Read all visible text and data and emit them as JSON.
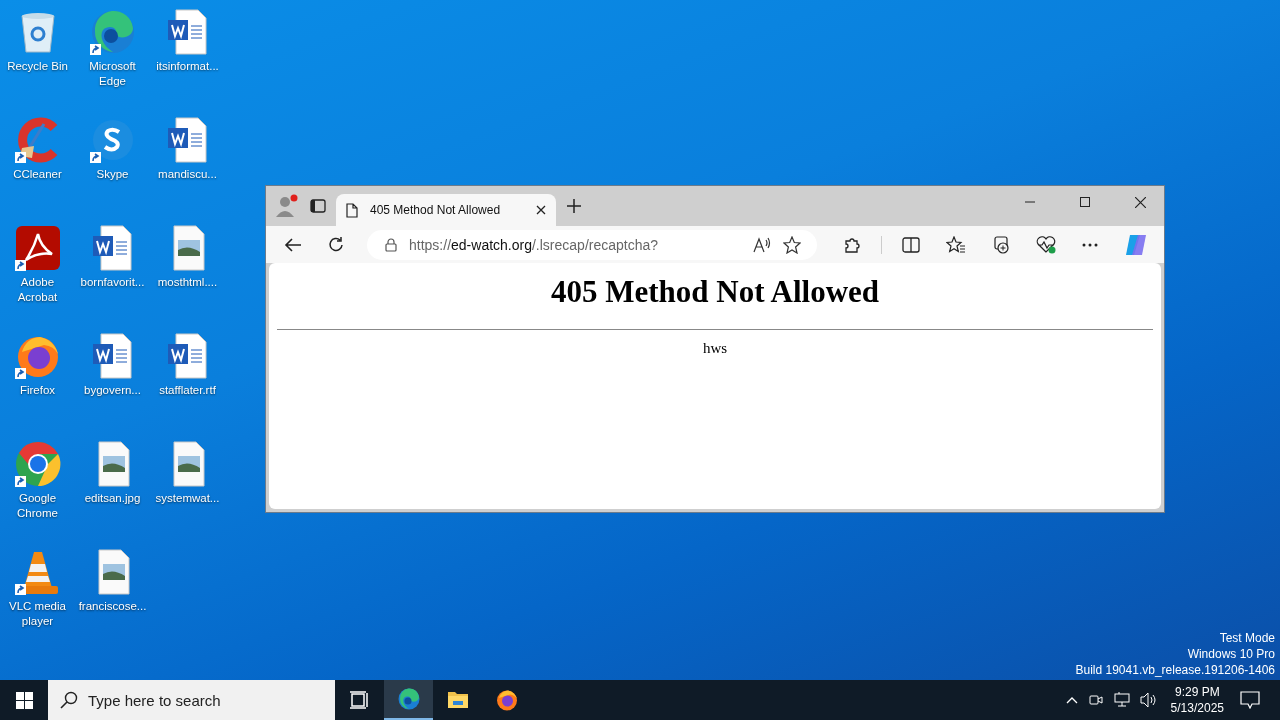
{
  "desktop_icons": [
    {
      "label": "Recycle Bin",
      "kind": "recycle",
      "shortcut": false
    },
    {
      "label": "CCleaner",
      "kind": "ccleaner",
      "shortcut": true
    },
    {
      "label": "Adobe Acrobat",
      "kind": "acrobat",
      "shortcut": true
    },
    {
      "label": "Firefox",
      "kind": "firefox",
      "shortcut": true
    },
    {
      "label": "Google Chrome",
      "kind": "chrome",
      "shortcut": true
    },
    {
      "label": "VLC media player",
      "kind": "vlc",
      "shortcut": true
    },
    {
      "label": "Microsoft Edge",
      "kind": "edge",
      "shortcut": true
    },
    {
      "label": "Skype",
      "kind": "skype",
      "shortcut": true
    },
    {
      "label": "bornfavorit...",
      "kind": "word",
      "shortcut": false
    },
    {
      "label": "bygovern...",
      "kind": "word",
      "shortcut": false
    },
    {
      "label": "editsan.jpg",
      "kind": "image",
      "shortcut": false
    },
    {
      "label": "franciscose...",
      "kind": "image",
      "shortcut": false
    },
    {
      "label": "itsinformat...",
      "kind": "word",
      "shortcut": false
    },
    {
      "label": "mandiscu...",
      "kind": "word",
      "shortcut": false
    },
    {
      "label": "mosthtml....",
      "kind": "image",
      "shortcut": false
    },
    {
      "label": "stafflater.rtf",
      "kind": "word",
      "shortcut": false
    },
    {
      "label": "systemwat...",
      "kind": "image",
      "shortcut": false
    }
  ],
  "browser": {
    "tabs": [
      {
        "title": "405 Method Not Allowed",
        "selected": true
      }
    ],
    "address": {
      "scheme": "https://",
      "host": "ed-watch.org",
      "path": "/.lsrecap/recaptcha?"
    },
    "page": {
      "heading": "405 Method Not Allowed",
      "server": "hws"
    }
  },
  "system_notice": [
    "Test Mode",
    "Windows 10 Pro",
    "Build 19041.vb_release.191206-1406"
  ],
  "taskbar": {
    "search_placeholder": "Type here to search",
    "apps": [
      {
        "kind": "taskview",
        "active": false
      },
      {
        "kind": "edge",
        "active": true
      },
      {
        "kind": "folder",
        "active": false
      },
      {
        "kind": "firefox",
        "active": false
      }
    ],
    "time": "9:29 PM",
    "date": "5/13/2025"
  }
}
